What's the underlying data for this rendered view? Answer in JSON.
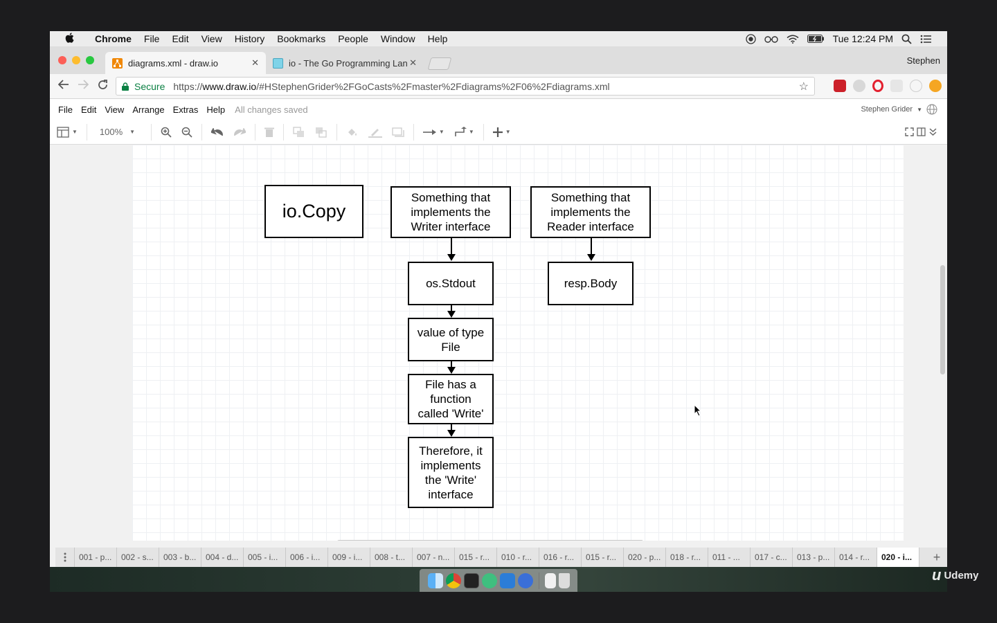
{
  "menubar": {
    "items": [
      {
        "label": "Chrome",
        "bold": true
      },
      {
        "label": "File"
      },
      {
        "label": "Edit"
      },
      {
        "label": "View"
      },
      {
        "label": "History"
      },
      {
        "label": "Bookmarks"
      },
      {
        "label": "People"
      },
      {
        "label": "Window"
      },
      {
        "label": "Help"
      }
    ],
    "clock": "Tue 12:24 PM",
    "status_icons": [
      "record-icon",
      "glasses-icon",
      "wifi-icon",
      "battery-icon",
      "spotlight-icon",
      "list-icon"
    ]
  },
  "browser": {
    "tabs": [
      {
        "title": "diagrams.xml - draw.io",
        "active": true
      },
      {
        "title": "io - The Go Programming Lang",
        "active": false
      }
    ],
    "profile": "Stephen",
    "secure_label": "Secure",
    "url_scheme": "https://",
    "url_host": "www.draw.io",
    "url_path": "/#HStephenGrider%2FGoCasts%2Fmaster%2Fdiagrams%2F06%2Fdiagrams.xml"
  },
  "drawio": {
    "menu": [
      "File",
      "Edit",
      "View",
      "Arrange",
      "Extras",
      "Help"
    ],
    "save_status": "All changes saved",
    "user": "Stephen Grider",
    "zoom": "100%"
  },
  "diagram": {
    "nodes": {
      "iocopy": "io.Copy",
      "writer": "Something that implements the Writer interface",
      "reader": "Something that implements the Reader interface",
      "stdout": "os.Stdout",
      "respbody": "resp.Body",
      "valuefile": "value of type File",
      "filewrite": "File has a function called 'Write'",
      "therefore": "Therefore, it implements the 'Write' interface"
    }
  },
  "page_tabs": [
    "001 - p...",
    "002 - s...",
    "003 - b...",
    "004 - d...",
    "005 - i...",
    "006 - i...",
    "009 - i...",
    "008 - t...",
    "007 - n...",
    "015 - r...",
    "010 - r...",
    "016 - r...",
    "015 - r...",
    "020 - p...",
    "018 - r...",
    "011 - ...",
    "017 - c...",
    "013 - p...",
    "014 - r...",
    "020 - i..."
  ],
  "active_page_tab": 19,
  "watermark": "Udemy"
}
